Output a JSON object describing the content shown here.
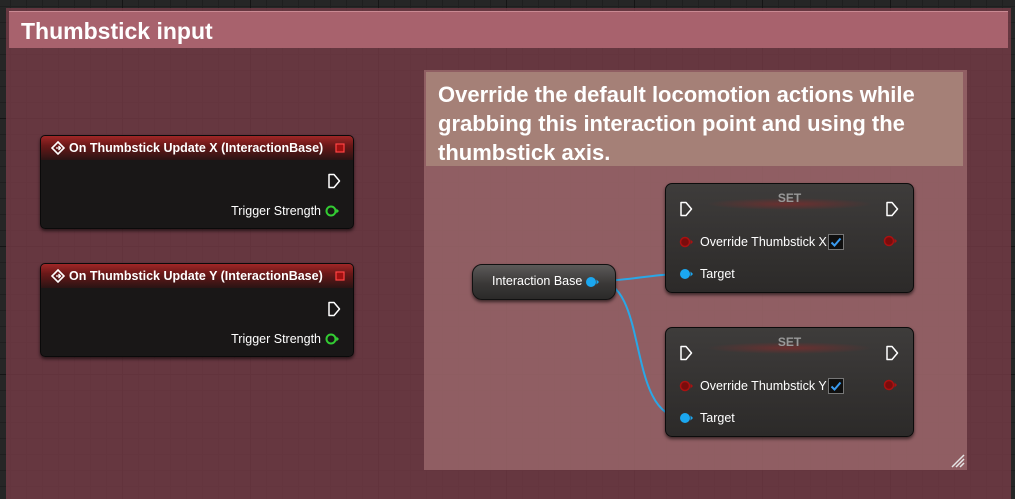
{
  "outer_comment": {
    "title": "Thumbstick input"
  },
  "inner_comment": {
    "title": "Override the default locomotion actions while grabbing this interaction point and using the thumbstick axis."
  },
  "event_x": {
    "title": "On Thumbstick Update X (InteractionBase)",
    "output_pin": "Trigger Strength"
  },
  "event_y": {
    "title": "On Thumbstick Update Y (InteractionBase)",
    "output_pin": "Trigger Strength"
  },
  "variable_node": {
    "label": "Interaction Base"
  },
  "set_x": {
    "title": "SET",
    "var_label": "Override Thumbstick X",
    "checked": true,
    "target_label": "Target"
  },
  "set_y": {
    "title": "SET",
    "var_label": "Override Thumbstick Y",
    "checked": true,
    "target_label": "Target"
  },
  "colors": {
    "exec_pin": "#ffffff",
    "float_pin": "#33cc33",
    "bool_pin": "#aa1111",
    "object_pin": "#1ba7f0",
    "event_header": "#a02727",
    "outer_comment": "#a8626d",
    "inner_comment": "#a58077"
  }
}
